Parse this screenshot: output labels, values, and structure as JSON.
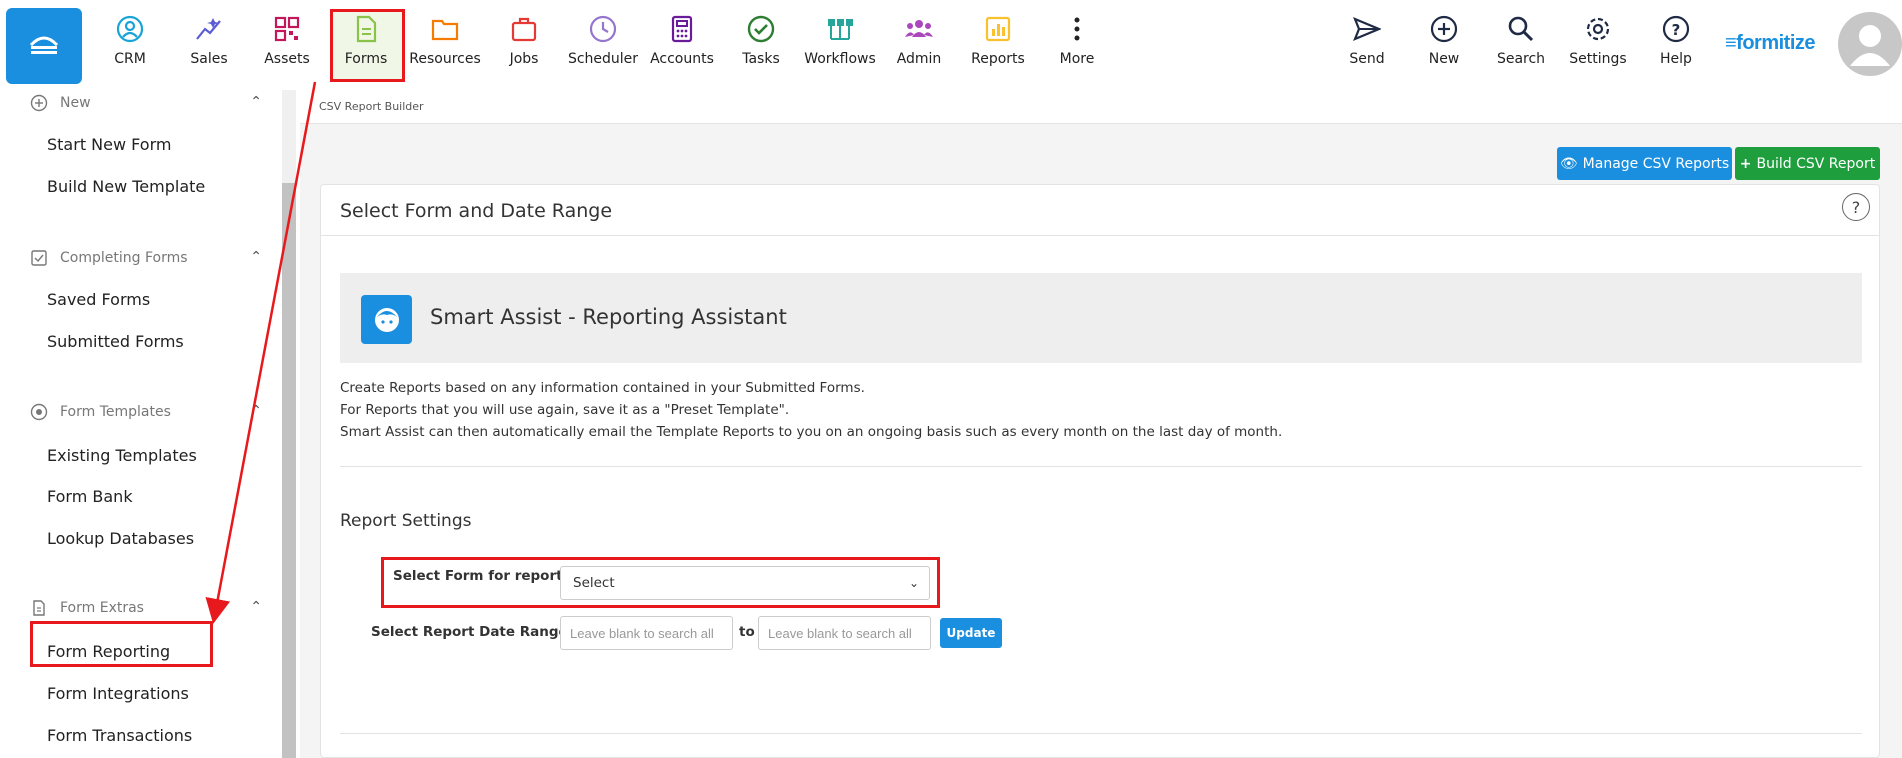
{
  "topnav": {
    "items": [
      {
        "label": "CRM",
        "icon": "crm-icon",
        "color": "#1aa3d6"
      },
      {
        "label": "Sales",
        "icon": "sales-icon",
        "color": "#5b5bd6"
      },
      {
        "label": "Assets",
        "icon": "assets-icon",
        "color": "#c2185b"
      },
      {
        "label": "Forms",
        "icon": "forms-icon",
        "color": "#8bc34a"
      },
      {
        "label": "Resources",
        "icon": "resources-icon",
        "color": "#f57c00"
      },
      {
        "label": "Jobs",
        "icon": "jobs-icon",
        "color": "#e53935"
      },
      {
        "label": "Scheduler",
        "icon": "scheduler-icon",
        "color": "#9575cd"
      },
      {
        "label": "Accounts",
        "icon": "accounts-icon",
        "color": "#6a1b9a"
      },
      {
        "label": "Tasks",
        "icon": "tasks-icon",
        "color": "#2e7d32"
      },
      {
        "label": "Workflows",
        "icon": "workflows-icon",
        "color": "#26a69a"
      },
      {
        "label": "Admin",
        "icon": "admin-icon",
        "color": "#ab47bc"
      },
      {
        "label": "Reports",
        "icon": "reports-icon",
        "color": "#fbc02d"
      },
      {
        "label": "More",
        "icon": "more-icon",
        "color": "#222222"
      }
    ],
    "right_items": [
      {
        "label": "Send",
        "icon": "send-icon"
      },
      {
        "label": "New",
        "icon": "new-icon"
      },
      {
        "label": "Search",
        "icon": "search-icon"
      },
      {
        "label": "Settings",
        "icon": "settings-icon"
      },
      {
        "label": "Help",
        "icon": "help-icon"
      }
    ],
    "brand": "formitize"
  },
  "sidebar": {
    "sections": [
      {
        "title": "New",
        "links": [
          "Start New Form",
          "Build New Template"
        ]
      },
      {
        "title": "Completing Forms",
        "links": [
          "Saved Forms",
          "Submitted Forms"
        ]
      },
      {
        "title": "Form Templates",
        "links": [
          "Existing Templates",
          "Form Bank",
          "Lookup Databases"
        ]
      },
      {
        "title": "Form Extras",
        "links": [
          "Form Reporting",
          "Form Integrations",
          "Form Transactions"
        ]
      }
    ]
  },
  "main": {
    "breadcrumb": "CSV Report Builder",
    "manage_btn": "Manage CSV Reports",
    "build_btn": "Build CSV Report",
    "card_title": "Select Form and Date Range",
    "assist_title": "Smart Assist - Reporting Assistant",
    "desc": [
      "Create Reports based on any information contained in your Submitted Forms.",
      "For Reports that you will use again, save it as a \"Preset Template\".",
      "Smart Assist can then automatically email the Template Reports to you on an ongoing basis such as every month on the last day of month."
    ],
    "report_settings_title": "Report Settings",
    "select_form_label": "Select Form for report:",
    "select_form_value": "Select",
    "date_range_label": "Select Report Date Range:",
    "date_placeholder": "Leave blank to search all",
    "to_label": "to",
    "update_btn": "Update"
  },
  "colors": {
    "primary": "#1a8fe0",
    "success": "#1f9e3e",
    "highlight": "#e8191c"
  }
}
